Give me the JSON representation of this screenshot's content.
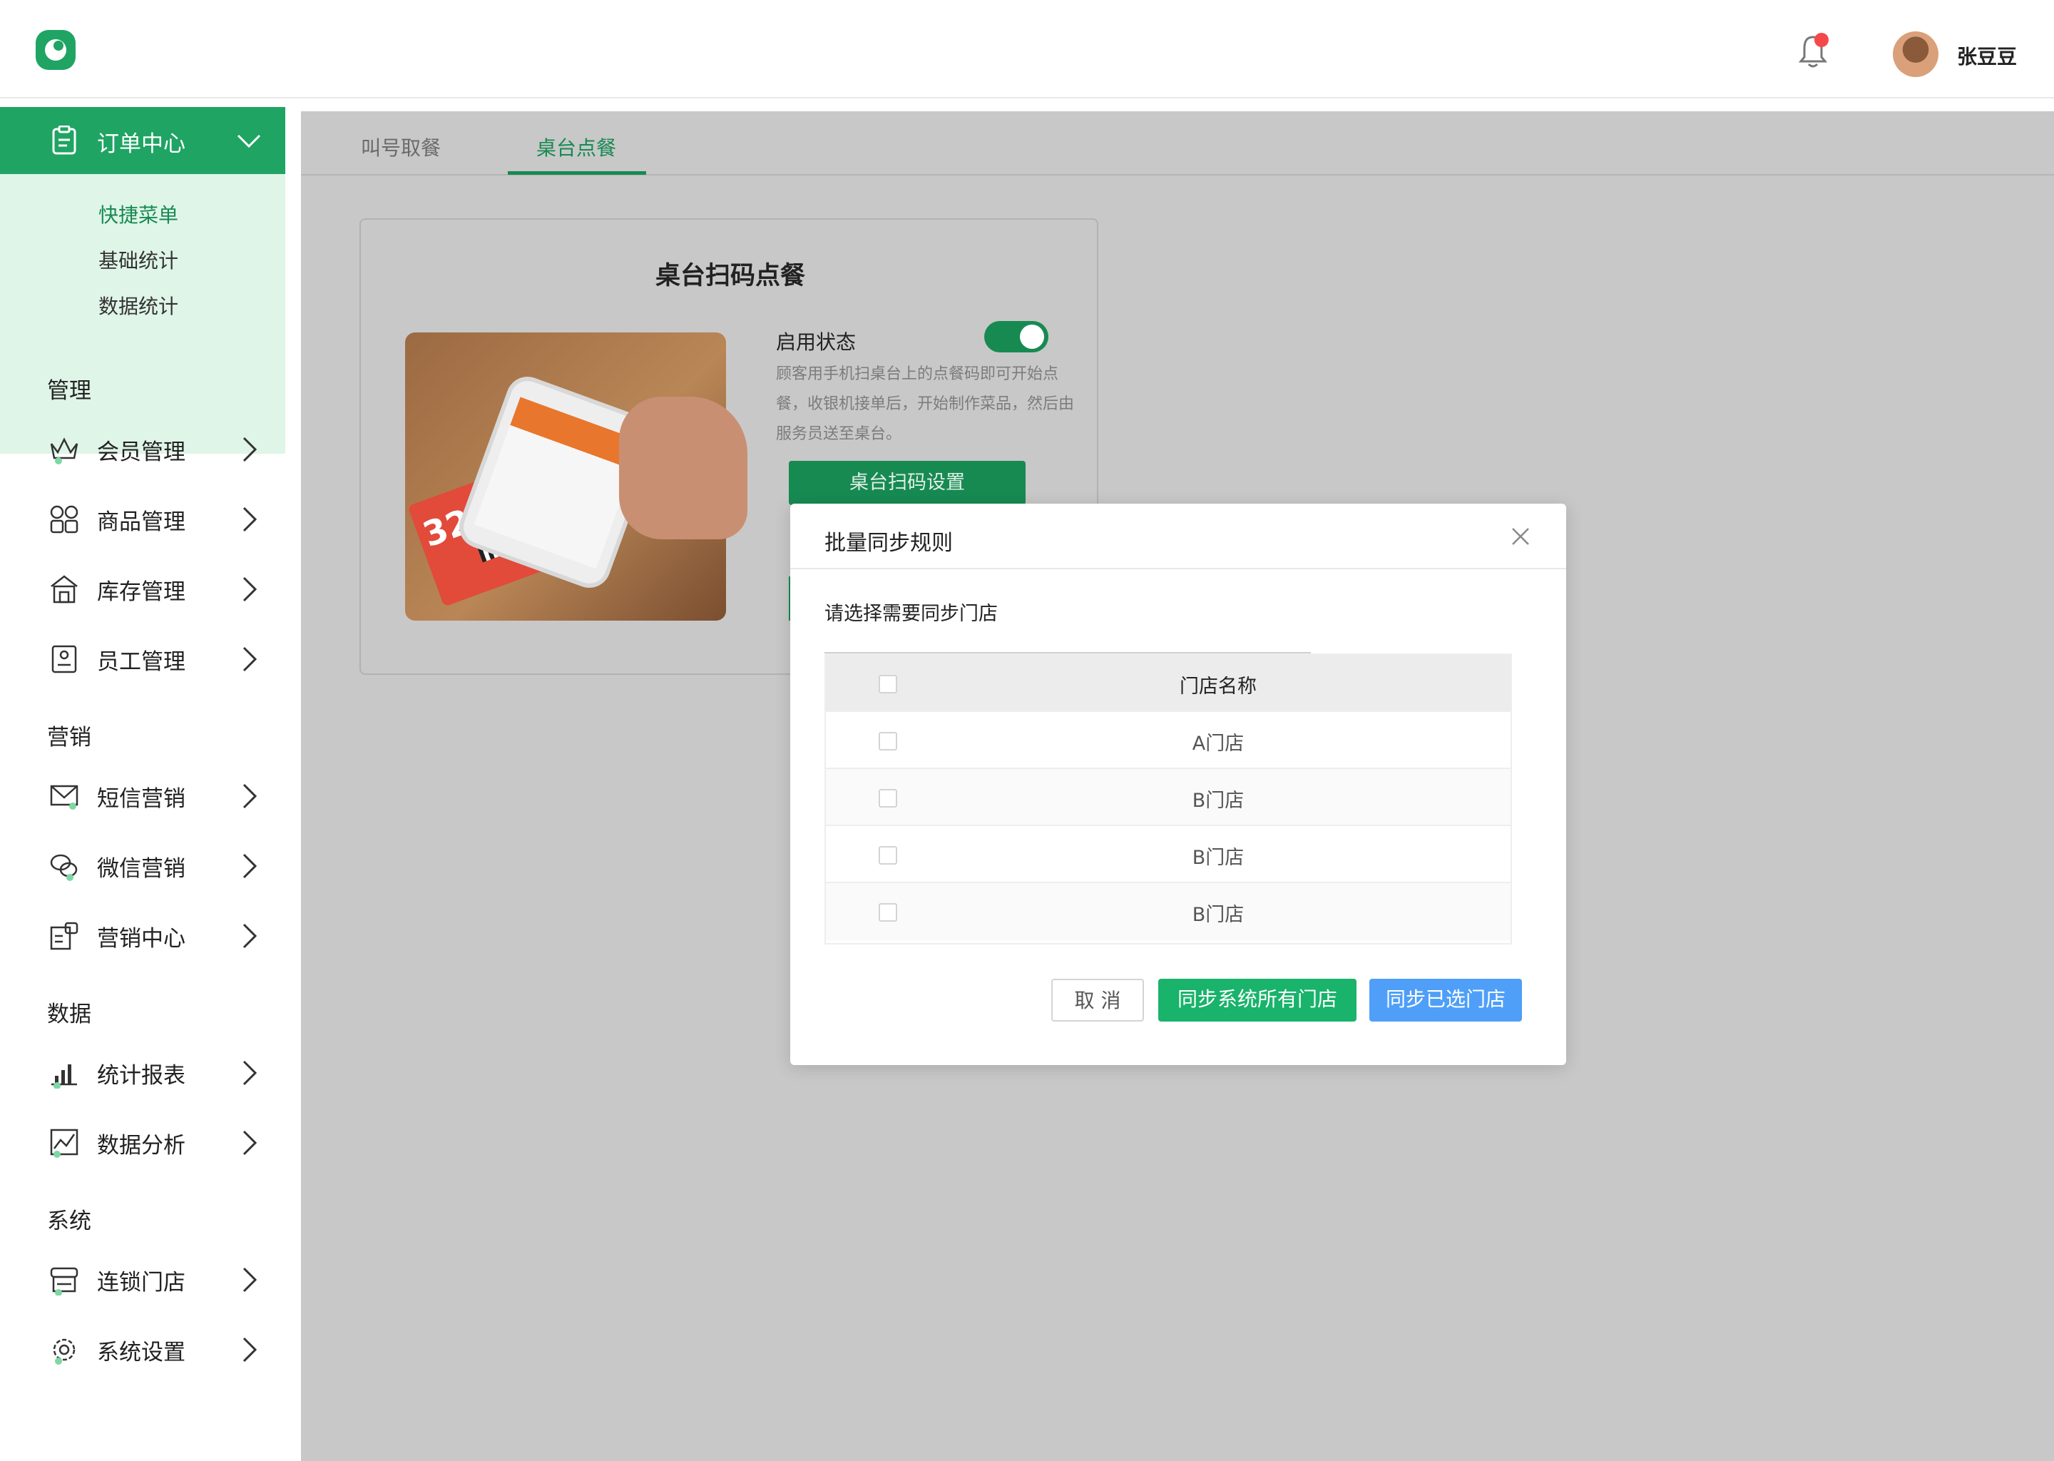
{
  "user": {
    "name": "张豆豆"
  },
  "sidebar": {
    "active": {
      "label": "订单中心"
    },
    "submenu": [
      "快捷菜单",
      "基础统计",
      "数据统计"
    ],
    "sections": [
      {
        "title": "管理",
        "items": [
          "会员管理",
          "商品管理",
          "库存管理",
          "员工管理"
        ]
      },
      {
        "title": "营销",
        "items": [
          "短信营销",
          "微信营销",
          "营销中心"
        ]
      },
      {
        "title": "数据",
        "items": [
          "统计报表",
          "数据分析"
        ]
      },
      {
        "title": "系统",
        "items": [
          "连锁门店",
          "系统设置"
        ]
      }
    ]
  },
  "tabs": [
    {
      "label": "叫号取餐",
      "active": false
    },
    {
      "label": "桌台点餐",
      "active": true
    }
  ],
  "card": {
    "title": "桌台扫码点餐",
    "enable_label": "启用状态",
    "enabled": true,
    "description": "顾客用手机扫桌台上的点餐码即可开始点餐，收银机接单后，开始制作菜品，然后由服务员送至桌台。",
    "settings_button": "桌台扫码设置",
    "ticket_number": "32"
  },
  "modal": {
    "title": "批量同步规则",
    "subtitle": "请选择需要同步门店",
    "table_header": "门店名称",
    "rows": [
      "A门店",
      "B门店",
      "B门店",
      "B门店"
    ],
    "buttons": {
      "cancel": "取 消",
      "sync_all": "同步系统所有门店",
      "sync_selected": "同步已选门店"
    }
  },
  "colors": {
    "primary": "#1fa464",
    "primary_dark": "#178a52",
    "submenu_bg": "#dff5e7",
    "sync_all": "#19b36b",
    "sync_selected": "#4f9ff8",
    "notify_dot": "#f5484a"
  }
}
